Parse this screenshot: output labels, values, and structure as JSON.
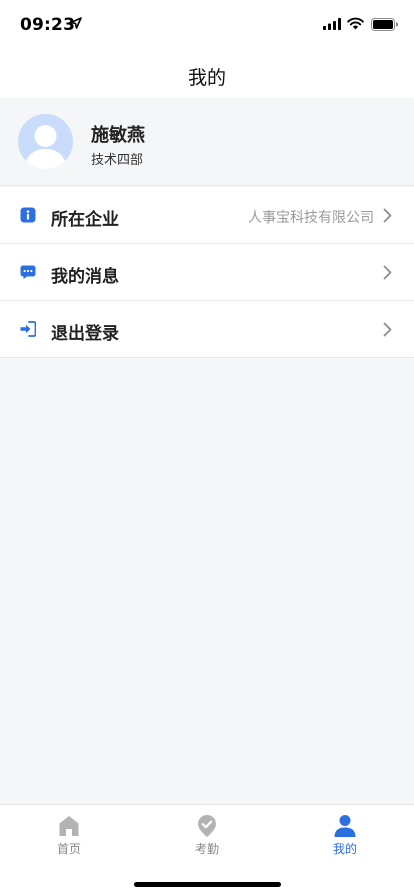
{
  "status_bar": {
    "time": "09:23"
  },
  "nav": {
    "title": "我的"
  },
  "profile": {
    "name": "施敏燕",
    "department": "技术四部"
  },
  "menu": {
    "company": {
      "label": "所在企业",
      "value": "人事宝科技有限公司",
      "icon": "info-icon"
    },
    "messages": {
      "label": "我的消息",
      "icon": "chat-bubble-icon"
    },
    "logout": {
      "label": "退出登录",
      "icon": "logout-icon"
    }
  },
  "tab_bar": {
    "tabs": [
      {
        "label": "首页",
        "icon": "home-icon"
      },
      {
        "label": "考勤",
        "icon": "location-check-icon"
      },
      {
        "label": "我的",
        "icon": "person-icon"
      }
    ],
    "active_index": 2
  },
  "colors": {
    "accent": "#2c6fe0",
    "inactive": "#888888",
    "avatar_bg": "#c9dcfb"
  }
}
